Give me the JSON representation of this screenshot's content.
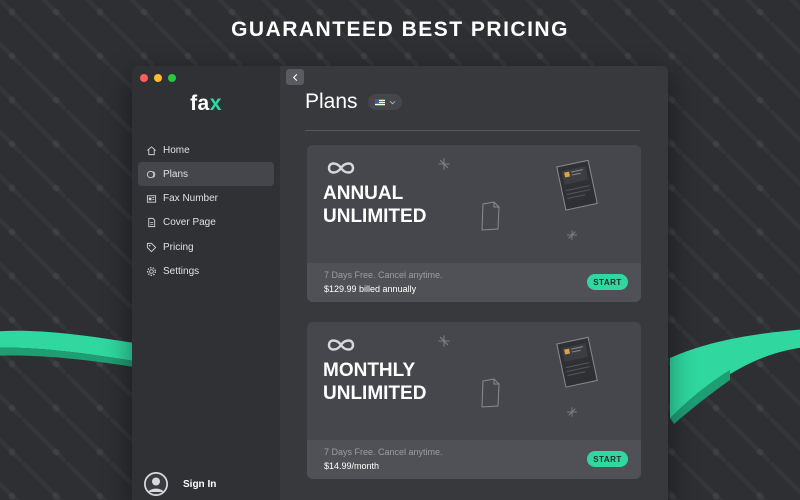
{
  "headline": "GUARANTEED BEST PRICING",
  "app": {
    "logo_main": "fa",
    "logo_accent": "x",
    "sidebar": {
      "items": [
        {
          "label": "Home",
          "icon": "home-icon"
        },
        {
          "label": "Plans",
          "icon": "plans-icon",
          "active": true
        },
        {
          "label": "Fax Number",
          "icon": "fax-icon"
        },
        {
          "label": "Cover Page",
          "icon": "document-icon"
        },
        {
          "label": "Pricing",
          "icon": "tag-icon"
        },
        {
          "label": "Settings",
          "icon": "gear-icon"
        }
      ],
      "sign_in_label": "Sign In"
    },
    "main": {
      "title": "Plans",
      "language_flag": "us-flag-icon",
      "plans": [
        {
          "name_line1": "ANNUAL",
          "name_line2": "UNLIMITED",
          "promo": "7 Days Free. Cancel anytime.",
          "price": "$129.99 billed annually",
          "button": "START"
        },
        {
          "name_line1": "MONTHLY",
          "name_line2": "UNLIMITED",
          "promo": "7 Days Free. Cancel anytime.",
          "price": "$14.99/month",
          "button": "START"
        }
      ]
    }
  },
  "colors": {
    "accent": "#30d8a0",
    "background": "#2e2f33",
    "window": "#38393d",
    "sidebar": "#303135",
    "card": "#46474c"
  }
}
